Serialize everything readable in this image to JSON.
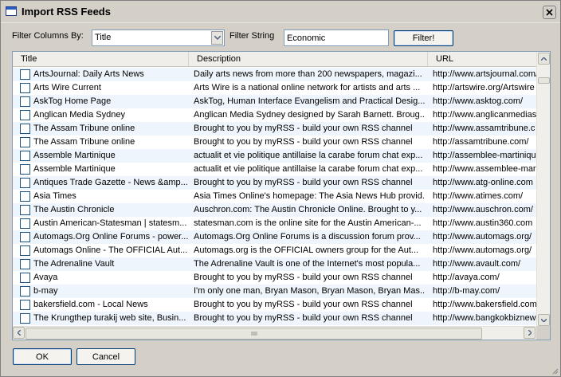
{
  "window": {
    "title": "Import RSS Feeds"
  },
  "filter": {
    "columns_label": "Filter Columns By:",
    "column_selected": "Title",
    "string_label": "Filter String",
    "string_value": "Economic",
    "button_label": "Filter!"
  },
  "table": {
    "columns": [
      "Title",
      "Description",
      "URL"
    ],
    "rows": [
      {
        "title": "ArtsJournal: Daily Arts News",
        "description": "Daily arts news from more than 200 newspapers, magazi...",
        "url": "http://www.artsjournal.com/"
      },
      {
        "title": "Arts Wire Current",
        "description": "Arts Wire is a national online network for artists and arts ...",
        "url": "http://artswire.org/Artswire"
      },
      {
        "title": "AskTog Home Page",
        "description": "AskTog, Human Interface Evangelism and Practical Desig...",
        "url": "http://www.asktog.com/"
      },
      {
        "title": "Anglican Media Sydney",
        "description": "Anglican Media Sydney designed by Sarah Barnett. Broug...",
        "url": "http://www.anglicanmedias"
      },
      {
        "title": "The Assam Tribune online",
        "description": "Brought to you by myRSS - build your own RSS channel",
        "url": "http://www.assamtribune.c"
      },
      {
        "title": "The Assam Tribune online",
        "description": "Brought to you by myRSS - build your own RSS channel",
        "url": "http://assamtribune.com/"
      },
      {
        "title": "Assemble Martinique",
        "description": "actualit et vie politique antillaise la carabe forum chat exp...",
        "url": "http://assemblee-martinique"
      },
      {
        "title": "Assemble Martinique",
        "description": "actualit et vie politique antillaise la carabe forum chat exp...",
        "url": "http://www.assemblee-mar"
      },
      {
        "title": "Antiques Trade Gazette - News &amp...",
        "description": "Brought to you by myRSS - build your own RSS channel",
        "url": "http://www.atg-online.com"
      },
      {
        "title": "Asia Times",
        "description": "Asia Times Online's homepage: The Asia News Hub provid...",
        "url": "http://www.atimes.com/"
      },
      {
        "title": "The Austin Chronicle",
        "description": "Auschron.com: The Austin Chronicle Online. Brought to y...",
        "url": "http://www.auschron.com/"
      },
      {
        "title": "Austin American-Statesman | statesm...",
        "description": "statesman.com is the online site for the Austin American-...",
        "url": "http://www.austin360.com"
      },
      {
        "title": "Automags.Org Online Forums - power...",
        "description": "Automags.Org Online Forums is a discussion forum prov...",
        "url": "http://www.automags.org/"
      },
      {
        "title": "Automags Online - The OFFICIAL Aut...",
        "description": "Automags.org is the OFFICIAL owners group for the Aut...",
        "url": "http://www.automags.org/"
      },
      {
        "title": "The Adrenaline Vault",
        "description": "The Adrenaline Vault is one of the Internet's most popula...",
        "url": "http://www.avault.com/"
      },
      {
        "title": "Avaya",
        "description": "Brought to you by myRSS - build your own RSS channel",
        "url": "http://avaya.com/"
      },
      {
        "title": "b-may",
        "description": "I'm only one man, Bryan Mason, Bryan Mason, Bryan Mas...",
        "url": "http://b-may.com/"
      },
      {
        "title": "bakersfield.com - Local News",
        "description": "Brought to you by myRSS - build your own RSS channel",
        "url": "http://www.bakersfield.com"
      },
      {
        "title": "The Krungthep turakij web site, Busin...",
        "description": "Brought to you by myRSS - build your own RSS channel",
        "url": "http://www.bangkokbiznew"
      }
    ]
  },
  "buttons": {
    "ok": "OK",
    "cancel": "Cancel"
  }
}
